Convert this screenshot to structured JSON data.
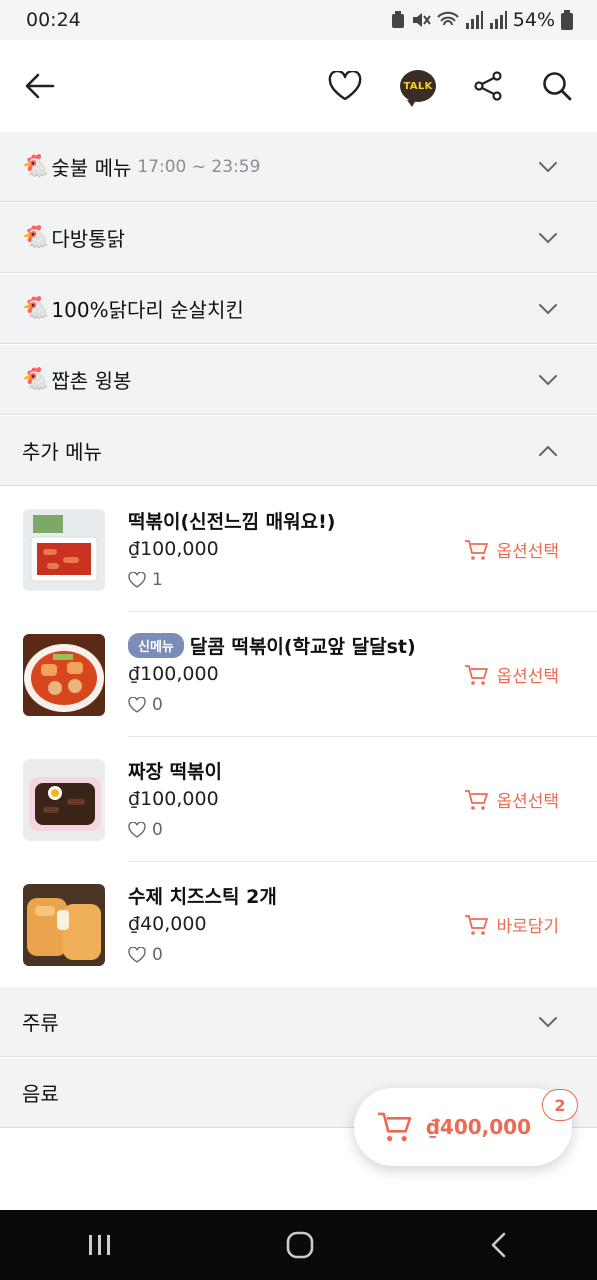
{
  "status": {
    "time": "00:24",
    "battery": "54%"
  },
  "header": {
    "talk_label": "TALK"
  },
  "categories": [
    {
      "icon": "🐔",
      "name": "숯불 메뉴",
      "time": "17:00 ~ 23:59",
      "expanded": false
    },
    {
      "icon": "🐔",
      "name": "다방통닭",
      "expanded": false
    },
    {
      "icon": "🐔",
      "name": "100%닭다리 순살치킨",
      "expanded": false
    },
    {
      "icon": "🐔",
      "name": "짭촌 윙봉",
      "expanded": false
    },
    {
      "name": "추가 메뉴",
      "expanded": true
    },
    {
      "name": "주류",
      "expanded": false
    },
    {
      "name": "음료",
      "expanded": false
    }
  ],
  "items": [
    {
      "name": "떡볶이(신전느낌 매워요!)",
      "badge": "",
      "price": "₫100,000",
      "likes": "1",
      "action": "옵션선택"
    },
    {
      "name": "달콤 떡볶이(학교앞 달달st)",
      "badge": "신메뉴",
      "price": "₫100,000",
      "likes": "0",
      "action": "옵션선택"
    },
    {
      "name": "짜장 떡볶이",
      "badge": "",
      "price": "₫100,000",
      "likes": "0",
      "action": "옵션선택"
    },
    {
      "name": "수제 치즈스틱 2개",
      "badge": "",
      "price": "₫40,000",
      "likes": "0",
      "action": "바로담기"
    }
  ],
  "cart": {
    "total": "₫400,000",
    "count": "2"
  },
  "colors": {
    "accent": "#ee6a52",
    "badge": "#7b8cb8",
    "category_bg": "#f2f3f5"
  }
}
